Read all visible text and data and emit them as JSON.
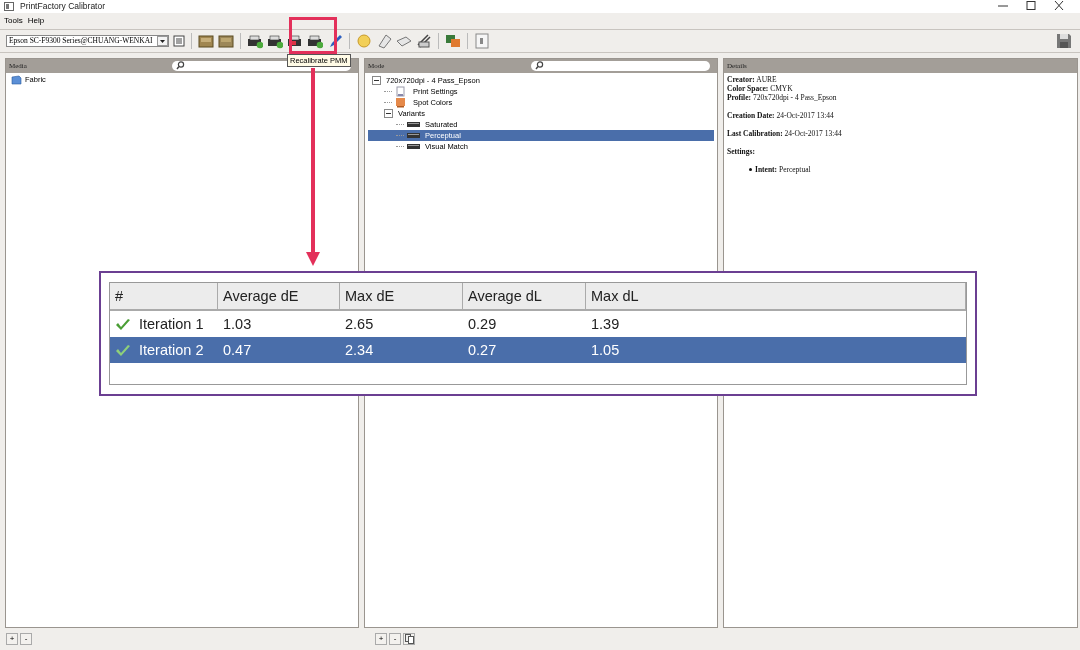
{
  "window": {
    "title": "PrintFactory Calibrator"
  },
  "menu": [
    {
      "label": "Tools"
    },
    {
      "label": "Help"
    }
  ],
  "toolbar": {
    "printer": "Epson SC-F9300 Series@CHUANG-WENKAI",
    "tooltip": "Recalibrate PMM"
  },
  "media_panel": {
    "title": "Media",
    "items": [
      {
        "label": "Fabric",
        "selected": false
      }
    ]
  },
  "mode_panel": {
    "title": "Mode",
    "tree": [
      {
        "label": "720x720dpi - 4 Pass_Epson",
        "kind": "folder",
        "expanded": true,
        "selected": false,
        "children": [
          {
            "label": "Print Settings",
            "kind": "settings",
            "selected": false
          },
          {
            "label": "Spot Colors",
            "kind": "spot",
            "selected": false
          },
          {
            "label": "Variants",
            "kind": "folder",
            "expanded": true,
            "selected": false,
            "children": [
              {
                "label": "Saturated",
                "kind": "variant",
                "selected": false
              },
              {
                "label": "Perceptual",
                "kind": "variant",
                "selected": true
              },
              {
                "label": "Visual Match",
                "kind": "variant",
                "selected": false
              }
            ]
          }
        ]
      }
    ]
  },
  "details_panel": {
    "title": "Details",
    "groups": [
      [
        {
          "text": "**Creator:** AURE"
        },
        {
          "text": "**Color Space:** CMYK"
        },
        {
          "text": "**Profile:** 720x720dpi - 4 Pass_Epson"
        }
      ],
      [
        {
          "text": "**Creation Date:** 24-Oct-2017 13:44"
        }
      ],
      [
        {
          "text": "**Last Calibration:** 24-Oct-2017 13:44"
        }
      ],
      [
        {
          "text": "Settings:",
          "kind": "heading"
        }
      ]
    ],
    "settings": [
      {
        "text": "**Intent:** Perceptual"
      }
    ]
  },
  "footer": {
    "left_buttons": [
      "+",
      "-"
    ],
    "mid_buttons": [
      "+",
      "-"
    ]
  },
  "calibration_table": {
    "columns": [
      "#",
      "Average dE",
      "Max dE",
      "Average dL",
      "Max dL"
    ],
    "rows": [
      {
        "cells": [
          "Iteration 1",
          "1.03",
          "2.65",
          "0.29",
          "1.39"
        ],
        "passed": true,
        "selected": false
      },
      {
        "cells": [
          "Iteration 2",
          "0.47",
          "2.34",
          "0.27",
          "1.05"
        ],
        "passed": true,
        "selected": true
      }
    ]
  }
}
